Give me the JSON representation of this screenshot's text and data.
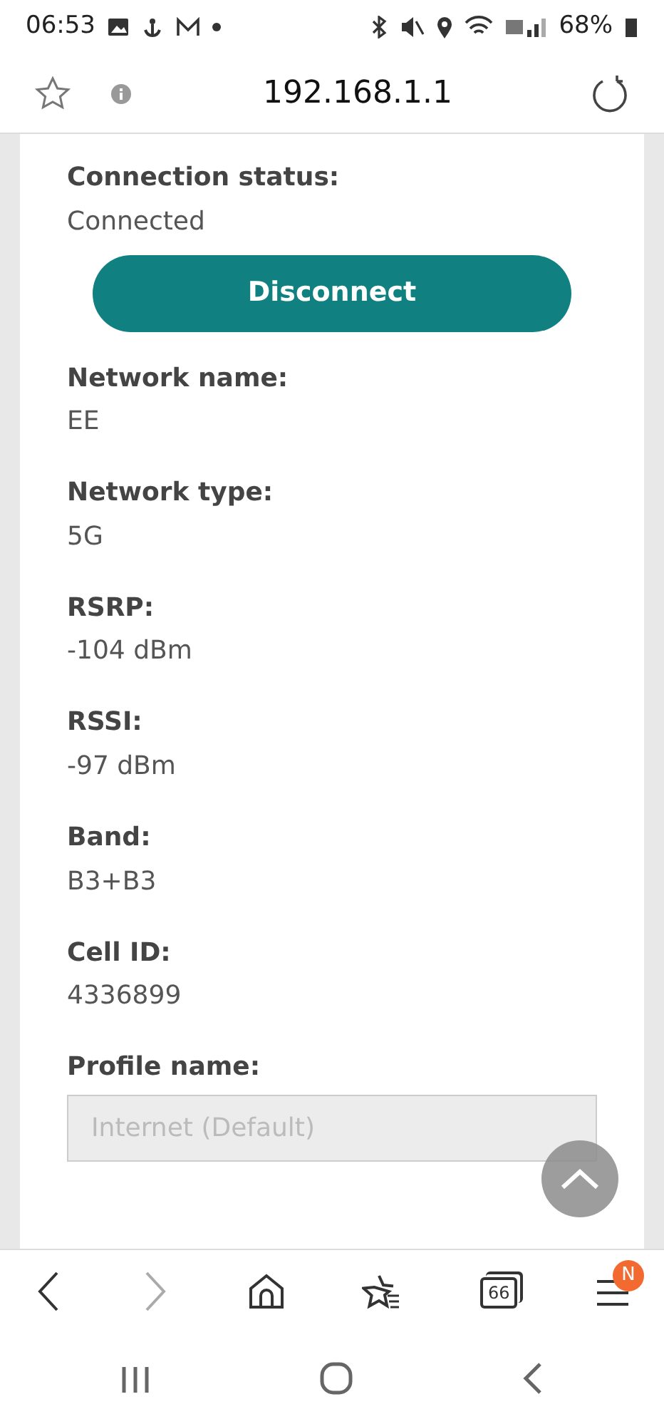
{
  "status_bar": {
    "time": "06:53",
    "battery": "68%"
  },
  "address_bar": {
    "url": "192.168.1.1"
  },
  "connection": {
    "label": "Connection status:",
    "value": "Connected",
    "button": "Disconnect"
  },
  "fields": [
    {
      "label": "Network name:",
      "value": "EE"
    },
    {
      "label": "Network type:",
      "value": "5G"
    },
    {
      "label": "RSRP:",
      "value": "-104 dBm"
    },
    {
      "label": "RSSI:",
      "value": "-97 dBm"
    },
    {
      "label": "Band:",
      "value": "B3+B3"
    },
    {
      "label": "Cell ID:",
      "value": "4336899"
    }
  ],
  "profile": {
    "label": "Profile name:",
    "value": "Internet (Default)",
    "disabled": true
  },
  "toolbar": [
    {
      "kind": "back",
      "disabled": false
    },
    {
      "kind": "forward",
      "disabled": true
    },
    {
      "kind": "home",
      "disabled": false
    },
    {
      "kind": "bookmarks",
      "disabled": false
    },
    {
      "kind": "tabs",
      "count": "66",
      "disabled": false
    },
    {
      "kind": "menu",
      "badge": "N",
      "disabled": false
    }
  ]
}
